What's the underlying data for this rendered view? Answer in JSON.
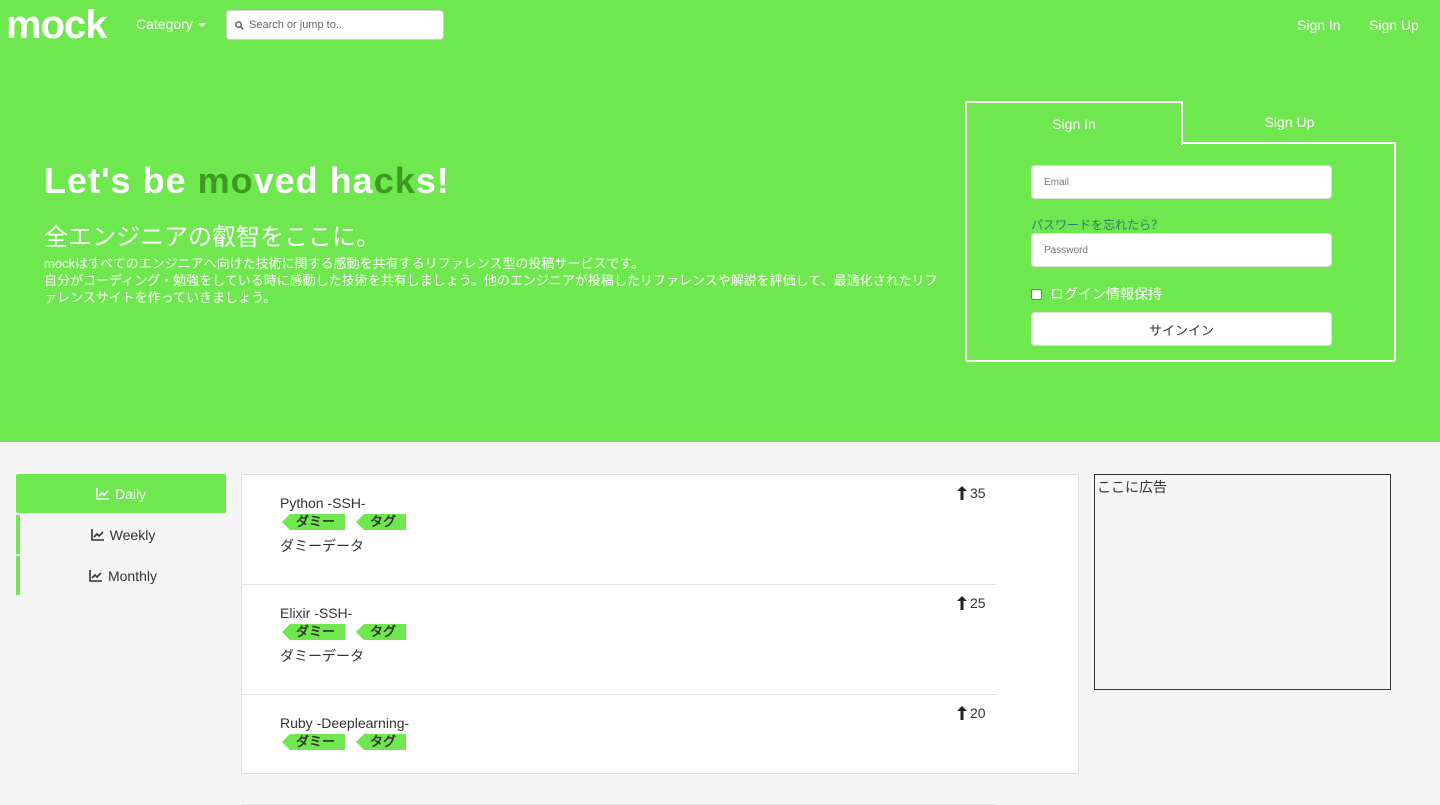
{
  "navbar": {
    "logo": "mock",
    "category_label": "Category",
    "search_placeholder": "Search or jump to..",
    "sign_in": "Sign In",
    "sign_up": "Sign Up"
  },
  "hero": {
    "title": {
      "p1": "Let's be ",
      "m": "m",
      "o": "o",
      "ved": "ved ",
      "ha": "ha",
      "ck": "ck",
      "s": "s!"
    },
    "subtitle": "全エンジニアの叡智をここに。",
    "description_line1": "mockはすべてのエンジニアへ向けた技術に関する感動を共有するリファレンス型の投稿サービスです。",
    "description_line2": "自分がコーディング・勉強をしている時に感動した技術を共有しましょう。他のエンジニアが投稿したリファレンスや解説を評価して、最適化されたリファレンスサイトを作っていきましょう。"
  },
  "auth": {
    "tab_sign_in": "Sign In",
    "tab_sign_up": "Sign Up",
    "email_placeholder": "Email",
    "forgot_password": "パスワードを忘れたら？",
    "password_placeholder": "Password",
    "remember_label": "ログイン情報保持",
    "submit_label": "サインイン"
  },
  "filters": [
    {
      "label": "Daily",
      "icon": "chart-line-icon",
      "active": true
    },
    {
      "label": "Weekly",
      "icon": "chart-line-icon",
      "active": false
    },
    {
      "label": "Monthly",
      "icon": "chart-line-icon",
      "active": false
    }
  ],
  "posts": [
    {
      "title": "Python -SSH-",
      "tags": [
        "ダミー",
        "タグ"
      ],
      "body": "ダミーデータ",
      "votes": "35"
    },
    {
      "title": "Elixir -SSH-",
      "tags": [
        "ダミー",
        "タグ"
      ],
      "body": "ダミーデータ",
      "votes": "25"
    },
    {
      "title": "Ruby -Deeplearning-",
      "tags": [
        "ダミー",
        "タグ"
      ],
      "body": "",
      "votes": "20"
    }
  ],
  "ad": {
    "text": "ここに広告"
  },
  "colors": {
    "brand_green": "#6fe74e",
    "dark_green": "#3c9a1e",
    "link_teal": "#2e7d6b"
  }
}
